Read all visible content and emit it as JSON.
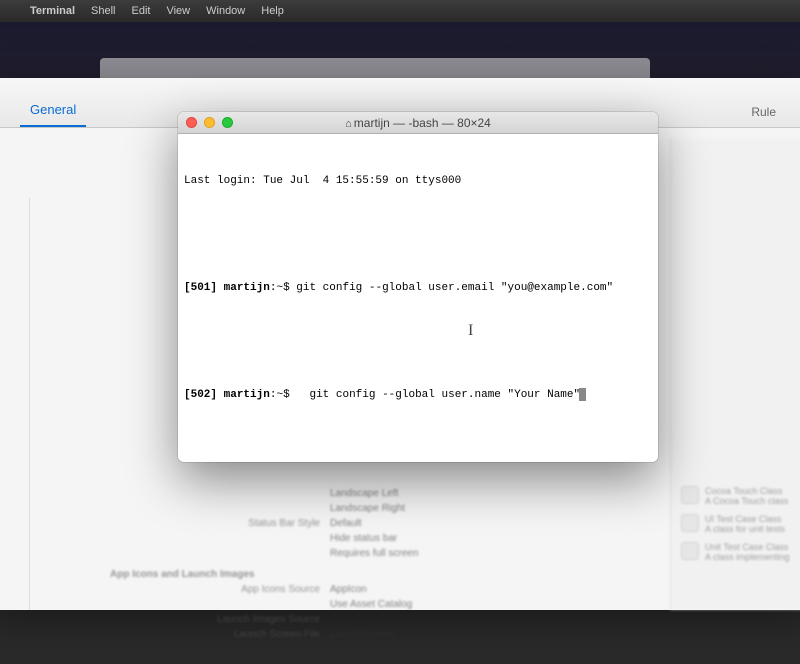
{
  "menubar": {
    "apple_icon": "",
    "app_name": "Terminal",
    "items": [
      "Shell",
      "Edit",
      "View",
      "Window",
      "Help"
    ]
  },
  "bg_window": {
    "tab_active": "General",
    "tab_right": "Rule",
    "rows": [
      {
        "label": "",
        "value": "Landscape Left"
      },
      {
        "label": "",
        "value": "Landscape Right"
      },
      {
        "label": "Status Bar Style",
        "value": "Default"
      },
      {
        "label": "",
        "value": "Hide status bar"
      },
      {
        "label": "",
        "value": "Requires full screen"
      }
    ],
    "section_title": "App Icons and Launch Images",
    "rows2": [
      {
        "label": "App Icons Source",
        "value": "AppIcon"
      },
      {
        "label": "",
        "value": "Use Asset Catalog"
      },
      {
        "label": "Launch Images Source",
        "value": ""
      },
      {
        "label": "Launch Screen File",
        "value": "LaunchScreen"
      }
    ],
    "right_items": [
      {
        "title": "Cocoa Touch Class",
        "sub": "A Cocoa Touch class"
      },
      {
        "title": "UI Test Case Class",
        "sub": "A class for unit tests"
      },
      {
        "title": "Unit Test Case Class",
        "sub": "A class implementing"
      }
    ]
  },
  "terminal": {
    "title": "martijn — -bash — 80×24",
    "home_icon": "⌂",
    "last_login": "Last login: Tue Jul  4 15:55:59 on ttys000",
    "lines": [
      {
        "num": "501",
        "user": "martijn",
        "path": "~",
        "cmd": "git config --global user.email \"you@example.com\""
      },
      {
        "num": "502",
        "user": "martijn",
        "path": "~",
        "cmd": "  git config --global user.name \"Your Name\""
      }
    ],
    "ibeam": "I"
  }
}
